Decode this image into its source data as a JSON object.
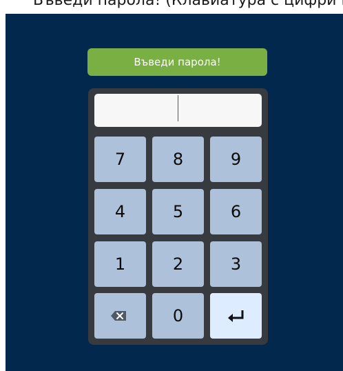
{
  "header": {
    "clipped_text": "Въведи парола! (Клавиатура с цифри и бутон за вход)"
  },
  "prompt": {
    "label": "Въведи парола!"
  },
  "keypad": {
    "keys": [
      "7",
      "8",
      "9",
      "4",
      "5",
      "6",
      "1",
      "2",
      "3",
      "0"
    ]
  },
  "icons": {
    "backspace": "backspace-icon",
    "enter": "enter-icon"
  },
  "colors": {
    "background": "#02294d",
    "prompt": "#7aaf44",
    "key": "#aec1da",
    "enter_key": "#ddecff",
    "keypad_frame": "#373b40"
  }
}
